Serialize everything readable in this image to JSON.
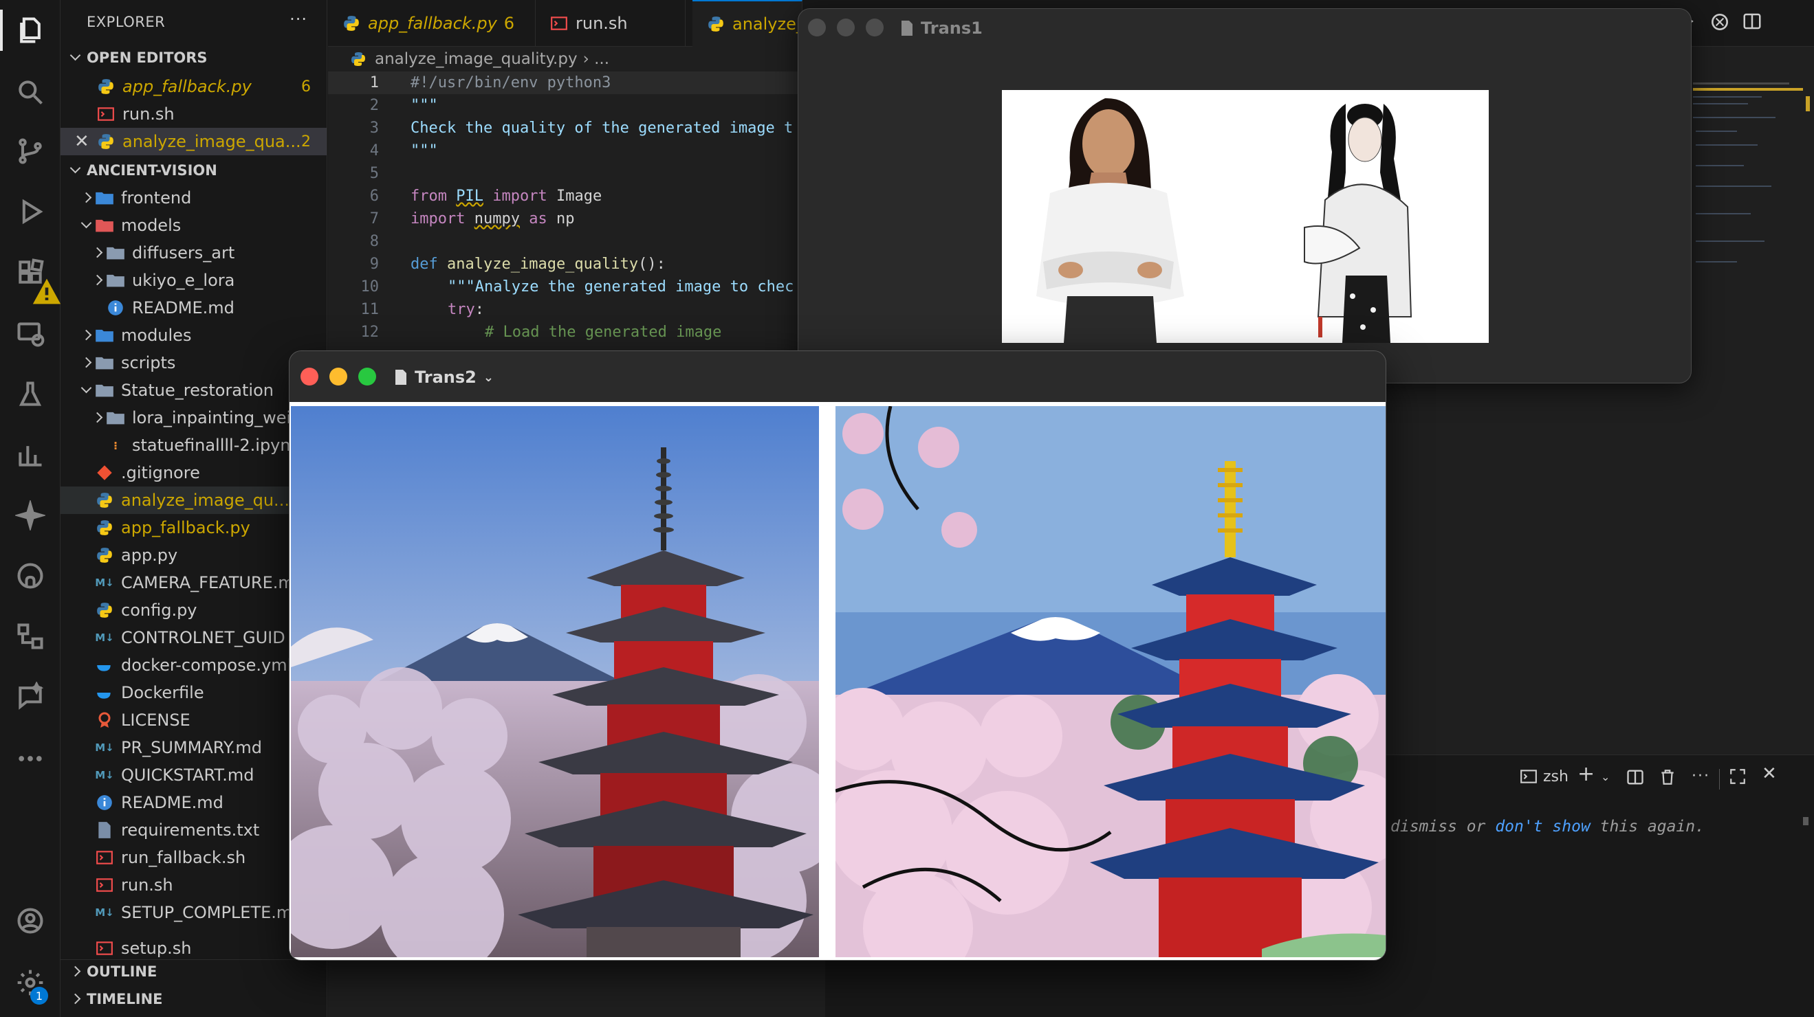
{
  "sidebar": {
    "title": "EXPLORER",
    "more": "···",
    "open_editors_header": "OPEN EDITORS",
    "open_editors": [
      {
        "name": "app_fallback.py",
        "count": "6"
      },
      {
        "name": "run.sh",
        "count": ""
      },
      {
        "name": "analyze_image_qua...",
        "count": "2"
      }
    ],
    "project_header": "ANCIENT-VISION",
    "tree": [
      {
        "name": "frontend"
      },
      {
        "name": "models"
      },
      {
        "name": "diffusers_art"
      },
      {
        "name": "ukiyo_e_lora"
      },
      {
        "name": "README.md"
      },
      {
        "name": "modules"
      },
      {
        "name": "scripts"
      },
      {
        "name": "Statue_restoration"
      },
      {
        "name": "lora_inpainting_weig"
      },
      {
        "name": "statuefinallll-2.ipyn"
      },
      {
        "name": ".gitignore"
      },
      {
        "name": "analyze_image_qu..."
      },
      {
        "name": "app_fallback.py"
      },
      {
        "name": "app.py"
      },
      {
        "name": "CAMERA_FEATURE.m"
      },
      {
        "name": "config.py"
      },
      {
        "name": "CONTROLNET_GUID"
      },
      {
        "name": "docker-compose.yml"
      },
      {
        "name": "Dockerfile"
      },
      {
        "name": "LICENSE"
      },
      {
        "name": "PR_SUMMARY.md"
      },
      {
        "name": "QUICKSTART.md"
      },
      {
        "name": "README.md"
      },
      {
        "name": "requirements.txt"
      },
      {
        "name": "run_fallback.sh"
      },
      {
        "name": "run.sh"
      },
      {
        "name": "SETUP_COMPLETE.m"
      },
      {
        "name": "setup.sh"
      }
    ],
    "outline_header": "OUTLINE",
    "timeline_header": "TIMELINE"
  },
  "tabs": [
    {
      "label": "app_fallback.py",
      "count": "6"
    },
    {
      "label": "run.sh"
    },
    {
      "label": "analyze_"
    }
  ],
  "breadcrumb": {
    "file": "analyze_image_quality.py",
    "rest": "› ..."
  },
  "code": {
    "line_numbers": [
      "1",
      "2",
      "3",
      "4",
      "5",
      "6",
      "7",
      "8",
      "9",
      "10",
      "11",
      "12"
    ],
    "l1": "#!/usr/bin/env python3",
    "l2": "\"\"\"",
    "l3": "Check the quality of the generated image t",
    "l4": "\"\"\"",
    "l6_from": "from",
    "l6_mod": "PIL",
    "l6_import": "import",
    "l6_name": "Image",
    "l7_import": "import",
    "l7_mod": "numpy",
    "l7_as": "as",
    "l7_alias": "np",
    "l9_def": "def",
    "l9_fn": "analyze_image_quality",
    "l9_rest": "():",
    "l10": "\"\"\"Analyze the generated image to chec",
    "l11_try": "try",
    "l11_colon": ":",
    "l12": "# Load the generated image"
  },
  "terminal": {
    "shell": "zsh",
    "hint_prefix": "dismiss or ",
    "hint_link": "don't show",
    "hint_suffix": " this again."
  },
  "window1": {
    "title": "Trans1"
  },
  "window2": {
    "title": "Trans2"
  },
  "colors": {
    "accent": "#0078d4",
    "warning": "#cca700"
  }
}
